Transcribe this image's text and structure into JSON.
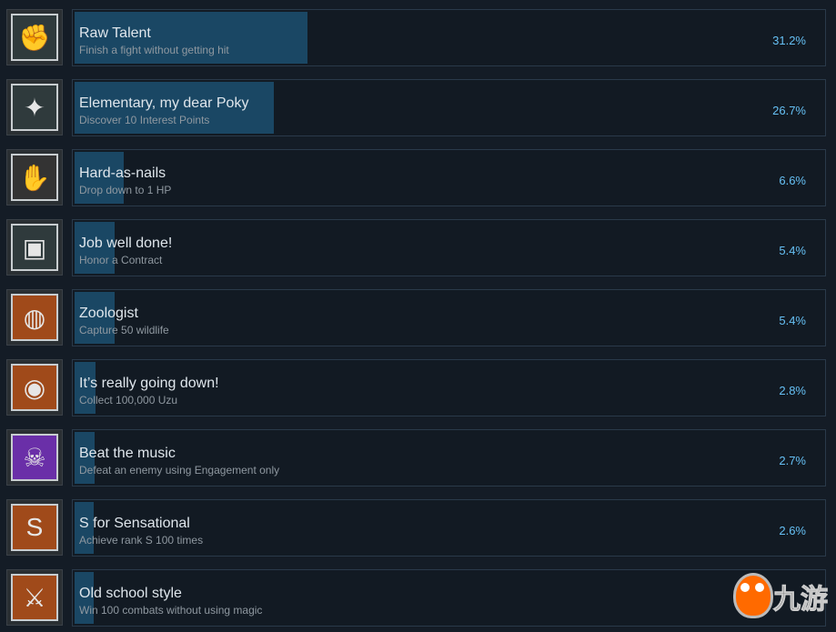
{
  "colors": {
    "background": "#141c26",
    "progress_fill": "#1a4764",
    "percent_text": "#66c0f4"
  },
  "achievements": [
    {
      "title": "Raw Talent",
      "description": "Finish a fight without getting hit",
      "percent_label": "31.2%",
      "percent": 31.2,
      "icon": "fighter-icon",
      "icon_color": "#2f3a3c"
    },
    {
      "title": "Elementary, my dear Poky",
      "description": "Discover 10 Interest Points",
      "percent_label": "26.7%",
      "percent": 26.7,
      "icon": "telescope-icon",
      "icon_color": "#2f3a3c"
    },
    {
      "title": "Hard-as-nails",
      "description": "Drop down to 1 HP",
      "percent_label": "6.6%",
      "percent": 6.6,
      "icon": "bandaged-fist-icon",
      "icon_color": "#333"
    },
    {
      "title": "Job well done!",
      "description": "Honor a Contract",
      "percent_label": "5.4%",
      "percent": 5.4,
      "icon": "contract-icon",
      "icon_color": "#2f3a3c"
    },
    {
      "title": "Zoologist",
      "description": "Capture 50 wildlife",
      "percent_label": "5.4%",
      "percent": 5.4,
      "icon": "net-icon",
      "icon_color": "#a04a1a"
    },
    {
      "title": "It’s really going down!",
      "description": "Collect 100,000 Uzu",
      "percent_label": "2.8%",
      "percent": 2.8,
      "icon": "money-bag-icon",
      "icon_color": "#a04a1a"
    },
    {
      "title": "Beat the music",
      "description": "Defeat an enemy using Engagement only",
      "percent_label": "2.7%",
      "percent": 2.7,
      "icon": "skull-hammer-icon",
      "icon_color": "#6a2fa8"
    },
    {
      "title": "S for Sensational",
      "description": "Achieve rank S 100 times",
      "percent_label": "2.6%",
      "percent": 2.6,
      "icon": "s-rank-icon",
      "icon_color": "#a04a1a"
    },
    {
      "title": "Old school style",
      "description": "Win 100 combats without using magic",
      "percent_label": "",
      "percent": 2.6,
      "icon": "sword-fist-icon",
      "icon_color": "#a04a1a"
    }
  ],
  "watermark": {
    "text": "九游"
  }
}
